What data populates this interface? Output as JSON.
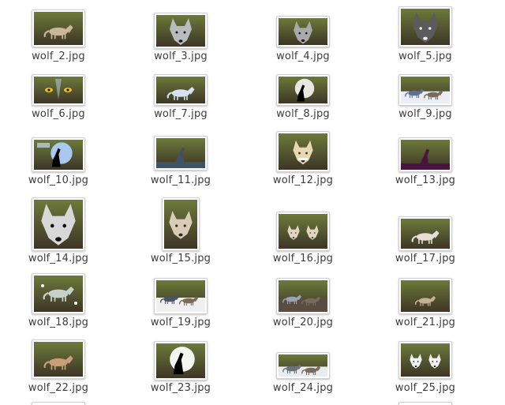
{
  "file_manager": {
    "items": [
      {
        "name": "wolf_2.jpg",
        "palette": [
          "#6c7a3a",
          "#3d3526",
          "#c9b79a"
        ],
        "subject": "wolf-standing"
      },
      {
        "name": "wolf_3.jpg",
        "palette": [
          "#2b3a4a",
          "#171d24",
          "#b9bcbf"
        ],
        "subject": "wolf-head"
      },
      {
        "name": "wolf_4.jpg",
        "palette": [
          "#2c2c2c",
          "#121212",
          "#a9a9a9"
        ],
        "subject": "wolf-head"
      },
      {
        "name": "wolf_5.jpg",
        "palette": [
          "#d9dadd",
          "#ececec",
          "#5b5b5e"
        ],
        "subject": "wolf-face"
      },
      {
        "name": "wolf_6.jpg",
        "palette": [
          "#1d2f6e",
          "#0c1230",
          "#c6d2f0"
        ],
        "subject": "wolf-eyes"
      },
      {
        "name": "wolf_7.jpg",
        "palette": [
          "#4d6a9e",
          "#2a3d5f",
          "#d8e2ee"
        ],
        "subject": "wolf-lying"
      },
      {
        "name": "wolf_8.jpg",
        "palette": [
          "#0a0a0a",
          "#000000",
          "#e8e8e0"
        ],
        "subject": "moon-howl"
      },
      {
        "name": "wolf_9.jpg",
        "palette": [
          "#8aa0c8",
          "#5f6f92",
          "#e9eef6"
        ],
        "subject": "wolf-pack"
      },
      {
        "name": "wolf_10.jpg",
        "palette": [
          "#0a0f2a",
          "#050814",
          "#a8c8f0"
        ],
        "subject": "moon-howl-text"
      },
      {
        "name": "wolf_11.jpg",
        "palette": [
          "#6f8aa0",
          "#3f5366",
          "#c9c2b5"
        ],
        "subject": "wolf-howl"
      },
      {
        "name": "wolf_12.jpg",
        "palette": [
          "#7a5a2a",
          "#3a2a12",
          "#e8d7b0"
        ],
        "subject": "wolf-snarl"
      },
      {
        "name": "wolf_13.jpg",
        "palette": [
          "#b03a8a",
          "#4a1440",
          "#f0a0c8"
        ],
        "subject": "wolf-howl-sunset"
      },
      {
        "name": "wolf_14.jpg",
        "palette": [
          "#2a2a2a",
          "#101010",
          "#d8d8d8"
        ],
        "subject": "wolf-face"
      },
      {
        "name": "wolf_15.jpg",
        "palette": [
          "#5a5040",
          "#2f2a20",
          "#d8ccb4"
        ],
        "subject": "wolf-face"
      },
      {
        "name": "wolf_16.jpg",
        "palette": [
          "#7a6a58",
          "#4a3c30",
          "#e0d4c4"
        ],
        "subject": "two-wolves"
      },
      {
        "name": "wolf_17.jpg",
        "palette": [
          "#9a8a72",
          "#6a5c48",
          "#e8e0d4"
        ],
        "subject": "wolf-profile"
      },
      {
        "name": "wolf_18.jpg",
        "palette": [
          "#2a3a30",
          "#16201a",
          "#c8d0cc"
        ],
        "subject": "wolf-lunge"
      },
      {
        "name": "wolf_19.jpg",
        "palette": [
          "#8a96aa",
          "#4c5466",
          "#f0f0f0"
        ],
        "subject": "wolves-snow"
      },
      {
        "name": "wolf_20.jpg",
        "palette": [
          "#dfe4ea",
          "#9aa4b0",
          "#5a4c40"
        ],
        "subject": "wolves-snow"
      },
      {
        "name": "wolf_21.jpg",
        "palette": [
          "#3a5a2a",
          "#1f3216",
          "#c8b094"
        ],
        "subject": "wolf-pup"
      },
      {
        "name": "wolf_22.jpg",
        "palette": [
          "#6a4a2a",
          "#3a2816",
          "#c8a078"
        ],
        "subject": "wolf-standing"
      },
      {
        "name": "wolf_23.jpg",
        "palette": [
          "#1a1a1a",
          "#050505",
          "#f4f4f0"
        ],
        "subject": "moon-howl"
      },
      {
        "name": "wolf_24.jpg",
        "palette": [
          "#b8c0c8",
          "#6a7078",
          "#e8ecef"
        ],
        "subject": "wolves-snow"
      },
      {
        "name": "wolf_25.jpg",
        "palette": [
          "#2a2a30",
          "#101014",
          "#f0f0f0"
        ],
        "subject": "husky-pair"
      }
    ]
  }
}
